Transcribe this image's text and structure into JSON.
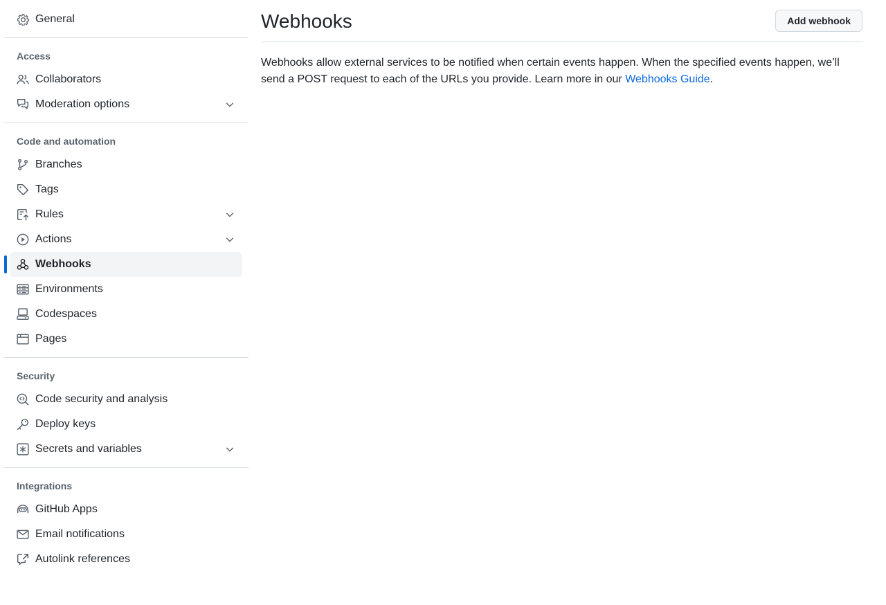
{
  "sidebar": {
    "top_item": {
      "label": "General",
      "icon": "gear-icon"
    },
    "groups": [
      {
        "heading": "Access",
        "items": [
          {
            "label": "Collaborators",
            "icon": "people-icon"
          },
          {
            "label": "Moderation options",
            "icon": "comment-discussion-icon",
            "expandable": true
          }
        ]
      },
      {
        "heading": "Code and automation",
        "items": [
          {
            "label": "Branches",
            "icon": "git-branch-icon"
          },
          {
            "label": "Tags",
            "icon": "tag-icon"
          },
          {
            "label": "Rules",
            "icon": "repo-push-icon",
            "expandable": true
          },
          {
            "label": "Actions",
            "icon": "play-icon",
            "expandable": true
          },
          {
            "label": "Webhooks",
            "icon": "webhook-icon",
            "active": true
          },
          {
            "label": "Environments",
            "icon": "server-icon"
          },
          {
            "label": "Codespaces",
            "icon": "codespaces-icon"
          },
          {
            "label": "Pages",
            "icon": "browser-icon"
          }
        ]
      },
      {
        "heading": "Security",
        "items": [
          {
            "label": "Code security and analysis",
            "icon": "codescan-icon"
          },
          {
            "label": "Deploy keys",
            "icon": "key-icon"
          },
          {
            "label": "Secrets and variables",
            "icon": "asterisk-icon",
            "expandable": true
          }
        ]
      },
      {
        "heading": "Integrations",
        "items": [
          {
            "label": "GitHub Apps",
            "icon": "copilot-icon"
          },
          {
            "label": "Email notifications",
            "icon": "mail-icon"
          },
          {
            "label": "Autolink references",
            "icon": "cross-reference-icon"
          }
        ]
      }
    ]
  },
  "main": {
    "title": "Webhooks",
    "add_button_label": "Add webhook",
    "description_text": "Webhooks allow external services to be notified when certain events happen. When the specified events happen, we’ll send a POST request to each of the URLs you provide. Learn more in our ",
    "description_link": "Webhooks Guide",
    "description_end": "."
  },
  "colors": {
    "accent": "#0969da",
    "text": "#1f2328",
    "muted": "#59636e",
    "border": "#d8dee4",
    "active_bg": "#f3f4f6"
  }
}
